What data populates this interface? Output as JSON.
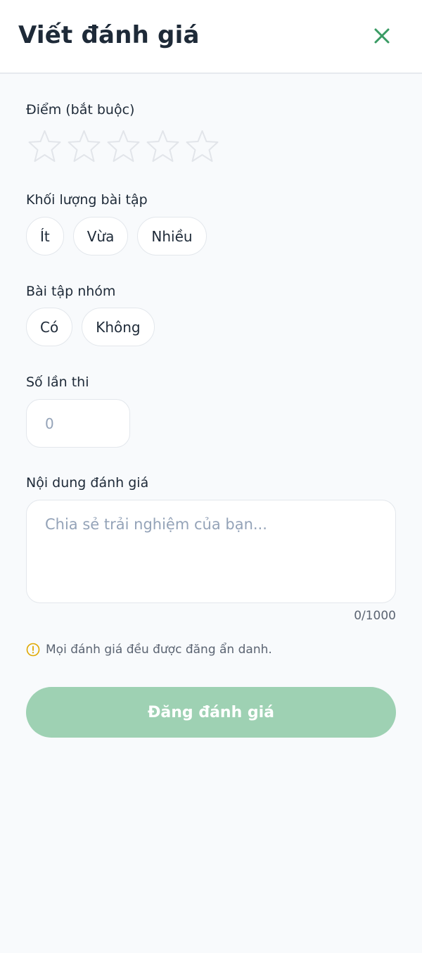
{
  "header": {
    "title": "Viết đánh giá",
    "close_icon": "close-icon"
  },
  "score": {
    "label": "Điểm (bắt buộc)",
    "max_stars": 5,
    "selected": 0
  },
  "workload": {
    "label": "Khối lượng bài tập",
    "options": [
      "Ít",
      "Vừa",
      "Nhiều"
    ]
  },
  "group_work": {
    "label": "Bài tập nhóm",
    "options": [
      "Có",
      "Không"
    ]
  },
  "exam_count": {
    "label": "Số lần thi",
    "placeholder": "0"
  },
  "review": {
    "label": "Nội dung đánh giá",
    "placeholder": "Chia sẻ trải nghiệm của bạn...",
    "counter": "0/1000"
  },
  "notice": {
    "text": "Mọi đánh giá đều được đăng ẩn danh.",
    "icon": "warning-icon"
  },
  "submit": {
    "label": "Đăng đánh giá"
  },
  "colors": {
    "accent": "#3a9b64",
    "submit_disabled": "#9ed1b3",
    "warning": "#e0a800"
  }
}
